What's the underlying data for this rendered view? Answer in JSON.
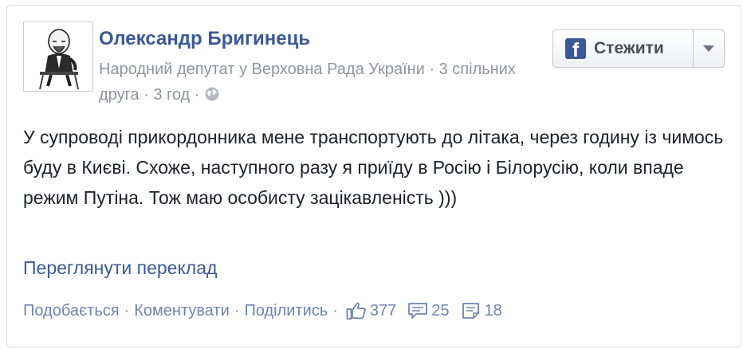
{
  "author": {
    "name": "Олександр Бригинець",
    "subtitle": "Народний депутат у Верховна Рада України",
    "mutual_friends": "3 спільних друга",
    "time": "3 год"
  },
  "follow_button": {
    "label": "Стежити",
    "brand_color": "#3b5998"
  },
  "post": {
    "text": "У супроводі прикордонника мене транспортують до літака, через годину із чимось буду в Києві. Схоже, наступного разу я приїду в Росію і Білорусію, коли впаде режим Путіна. Тож маю особисту зацікавленість )))",
    "translate_link": "Переглянути переклад"
  },
  "actions": {
    "like": "Подобається",
    "comment": "Коментувати",
    "share": "Поділитись",
    "separator": "·"
  },
  "stats": {
    "likes": "377",
    "comments": "25",
    "shares": "18"
  },
  "icons": {
    "globe": "globe-icon",
    "like": "thumbs-up-icon",
    "comment": "comment-bubble-icon",
    "share": "share-note-icon",
    "facebook": "facebook-logo-icon",
    "dropdown": "chevron-down-icon"
  },
  "colors": {
    "link": "#3b5998",
    "action": "#6d84b4",
    "muted": "#90949c",
    "text": "#1d2129"
  }
}
